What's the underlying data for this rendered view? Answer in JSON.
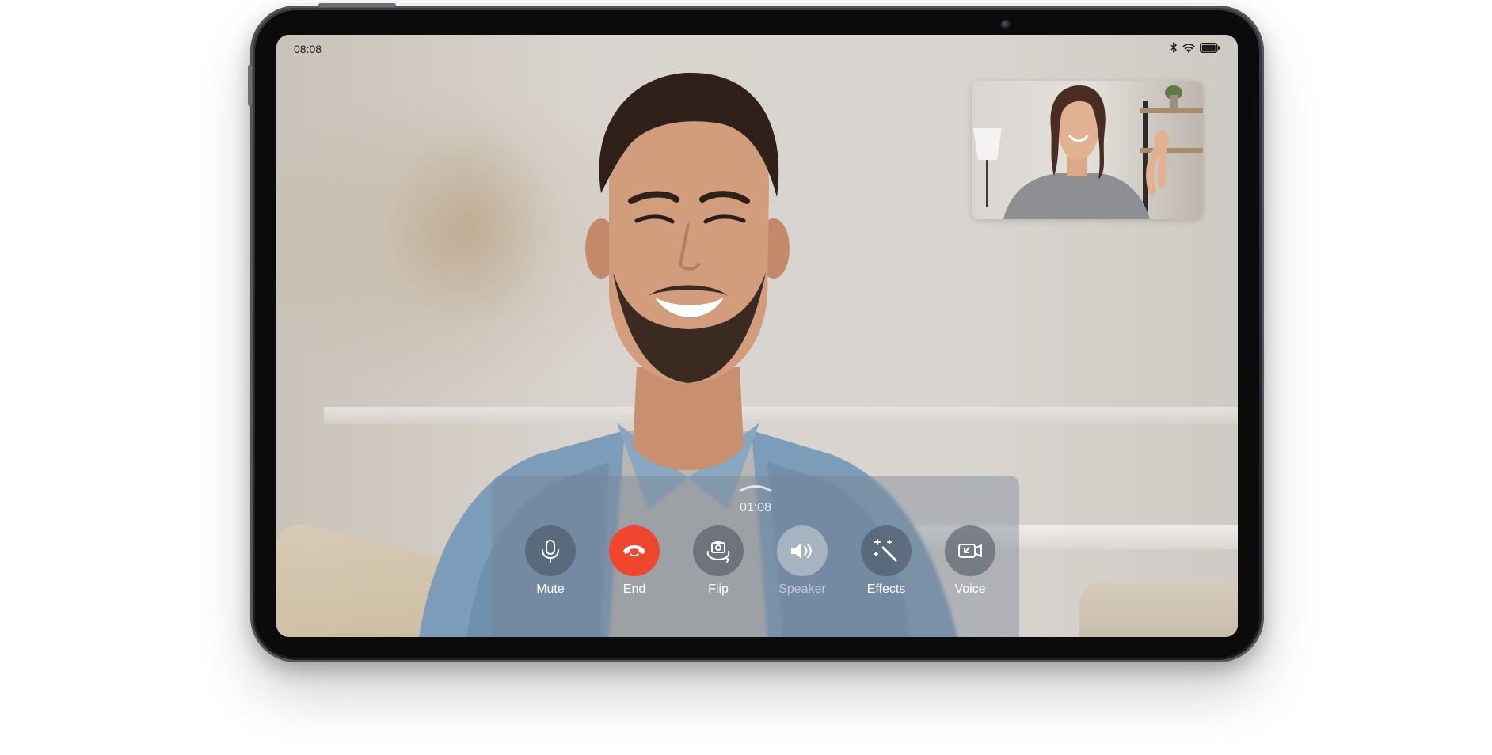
{
  "status_bar": {
    "time": "08:08",
    "icons": [
      "bluetooth-icon",
      "wifi-icon",
      "battery-icon"
    ]
  },
  "call": {
    "duration": "01:08",
    "controls": [
      {
        "id": "mute",
        "label": "Mute",
        "icon": "microphone-icon"
      },
      {
        "id": "end",
        "label": "End",
        "icon": "hang-up-icon"
      },
      {
        "id": "flip",
        "label": "Flip",
        "icon": "flip-camera-icon"
      },
      {
        "id": "speaker",
        "label": "Speaker",
        "icon": "speaker-icon"
      },
      {
        "id": "effects",
        "label": "Effects",
        "icon": "magic-wand-icon"
      },
      {
        "id": "voice",
        "label": "Voice",
        "icon": "switch-to-voice-icon"
      }
    ]
  },
  "colors": {
    "end_button": "#f0462d",
    "device_frame": "#1b1c1e"
  }
}
